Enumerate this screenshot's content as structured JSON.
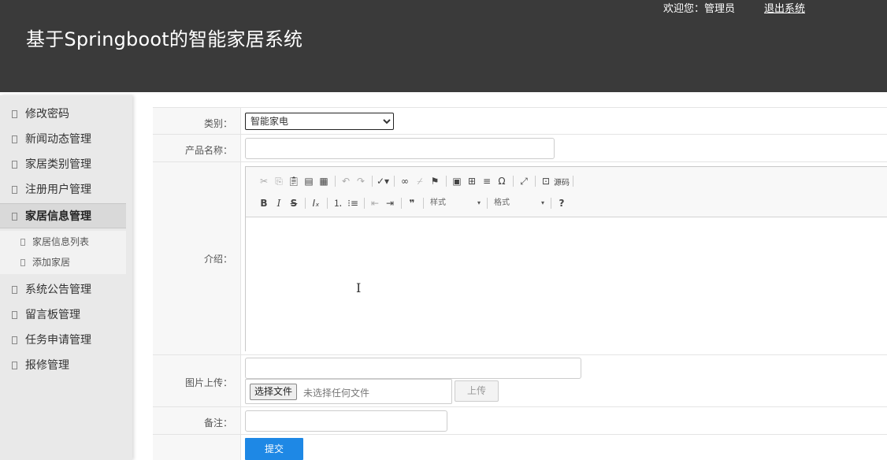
{
  "header": {
    "title": "基于Springboot的智能家居系统",
    "welcome": "欢迎您：管理员",
    "logout": "退出系统"
  },
  "sidebar": {
    "items": [
      {
        "label": "修改密码"
      },
      {
        "label": "新闻动态管理"
      },
      {
        "label": "家居类别管理"
      },
      {
        "label": "注册用户管理"
      },
      {
        "label": "家居信息管理"
      },
      {
        "label": "系统公告管理"
      },
      {
        "label": "留言板管理"
      },
      {
        "label": "任务申请管理"
      },
      {
        "label": "报修管理"
      }
    ],
    "active_item": "家居信息管理",
    "subitems": [
      {
        "label": "家居信息列表"
      },
      {
        "label": "添加家居"
      }
    ]
  },
  "form": {
    "category_label": "类别：",
    "category_value": "智能家电",
    "product_name_label": "产品名称：",
    "product_name_value": "",
    "intro_label": "介绍：",
    "image_label": "图片上传：",
    "choose_file": "选择文件",
    "no_file": "未选择任何文件",
    "upload": "上传",
    "remark_label": "备注：",
    "submit": "提交"
  },
  "editor": {
    "source_label": "源码",
    "style_combo": "样式",
    "format_combo": "格式",
    "toolbar_icons_row1": [
      "cut-icon",
      "copy-icon",
      "paste-icon",
      "paste-text-icon",
      "paste-word-icon",
      "undo-icon",
      "redo-icon",
      "spellcheck-icon",
      "link-icon",
      "unlink-icon",
      "anchor-icon",
      "image-icon",
      "table-icon",
      "horizontal-rule-icon",
      "special-char-icon",
      "maximize-icon",
      "source-icon"
    ],
    "toolbar_icons_row2": [
      "bold-icon",
      "italic-icon",
      "strike-icon",
      "remove-format-icon",
      "numbered-list-icon",
      "bulleted-list-icon",
      "outdent-icon",
      "indent-icon",
      "blockquote-icon",
      "help-icon"
    ]
  }
}
